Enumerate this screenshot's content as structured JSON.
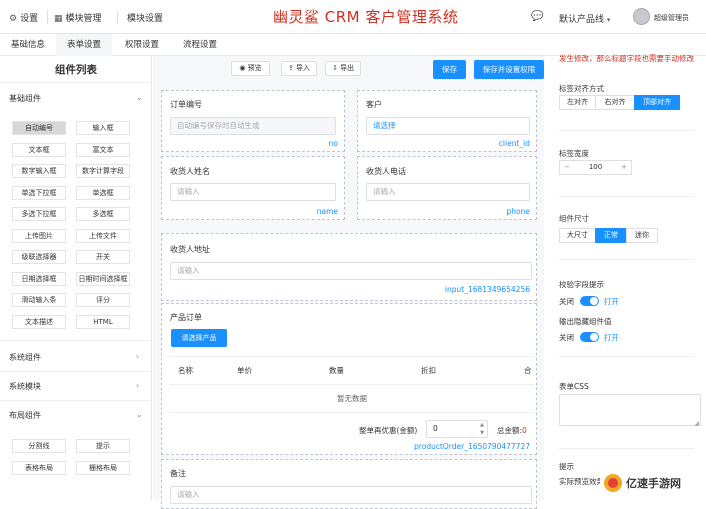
{
  "topbar": {
    "settings_icon": "gear-icon",
    "settings_label": "设置",
    "module_mgmt_icon": "grid-icon",
    "module_mgmt_label": "模块管理",
    "module_settings_label": "模块设置",
    "app_title": "幽灵鲨 CRM 客户管理系统",
    "message_icon": "chat-icon",
    "product_line_label": "默认产品线",
    "product_line_chevron": "chevron-down-icon",
    "user_name": "超级管理员"
  },
  "tabs": [
    {
      "label": "基础信息"
    },
    {
      "label": "表单设置"
    },
    {
      "label": "权限设置"
    },
    {
      "label": "流程设置"
    }
  ],
  "sidebar": {
    "title": "组件列表",
    "basic": {
      "label": "基础组件",
      "items": [
        "自动编号",
        "输入框",
        "文本框",
        "富文本",
        "数字输入框",
        "数字计算字段",
        "单选下拉框",
        "单选框",
        "多选下拉框",
        "多选框",
        "上传图片",
        "上传文件",
        "级联选择器",
        "开关",
        "日期选择框",
        "日期时间选择框",
        "滑动输入条",
        "评分",
        "文本描述",
        "HTML"
      ]
    },
    "system": {
      "label": "系统组件"
    },
    "system_module": {
      "label": "系统模块"
    },
    "layout": {
      "label": "布局组件",
      "items": [
        "分割线",
        "提示",
        "表格布局",
        "栅格布局"
      ]
    }
  },
  "toolbar": {
    "preview": "预览",
    "import": "导入",
    "export": "导出",
    "save": "保存",
    "save_permission": "保存并设置权限"
  },
  "form": {
    "order_no": {
      "label": "订单编号",
      "placeholder": "自动编号保存时自动生成",
      "key": "no"
    },
    "customer": {
      "label": "客户",
      "value": "请选择",
      "key": "client_id"
    },
    "receiver_name": {
      "label": "收货人姓名",
      "placeholder": "请输入",
      "key": "name"
    },
    "receiver_phone": {
      "label": "收货人电话",
      "placeholder": "请输入",
      "key": "phone"
    },
    "receiver_address": {
      "label": "收货人地址",
      "placeholder": "请输入",
      "key": "input_1681349654256"
    },
    "product_order": {
      "label": "产品订单",
      "select_button": "请选择产品",
      "columns": [
        "名称",
        "单价",
        "数量",
        "折扣",
        "合"
      ],
      "empty_text": "暂无数据",
      "discount_label": "整单再优惠(金额)",
      "discount_value": "0",
      "total_label": "总金额:",
      "total_value": "0",
      "key": "productOrder_1650790477727"
    },
    "remark": {
      "label": "备注",
      "placeholder": "请输入"
    }
  },
  "props": {
    "warning_text": "发生修改，那么标题字段也需要手动修改",
    "label_align": {
      "label": "标签对齐方式",
      "options": [
        "左对齐",
        "右对齐",
        "顶部对齐"
      ],
      "selected": "顶部对齐"
    },
    "label_width": {
      "label": "标签宽度",
      "minus": "−",
      "value": "100",
      "plus": "+"
    },
    "component_size": {
      "label": "组件尺寸",
      "options": [
        "大尺寸",
        "正常",
        "迷你"
      ],
      "selected": "正常"
    },
    "validate_hint": {
      "label": "校验字段提示",
      "off": "关闭",
      "on": "打开"
    },
    "output_hidden": {
      "label": "输出隐藏组件值",
      "off": "关闭",
      "on": "打开"
    },
    "form_css": {
      "label": "表单CSS"
    },
    "tip": {
      "label": "提示",
      "text": "实际预览效果请点击预览按钮"
    }
  },
  "watermark": "亿速手游网"
}
